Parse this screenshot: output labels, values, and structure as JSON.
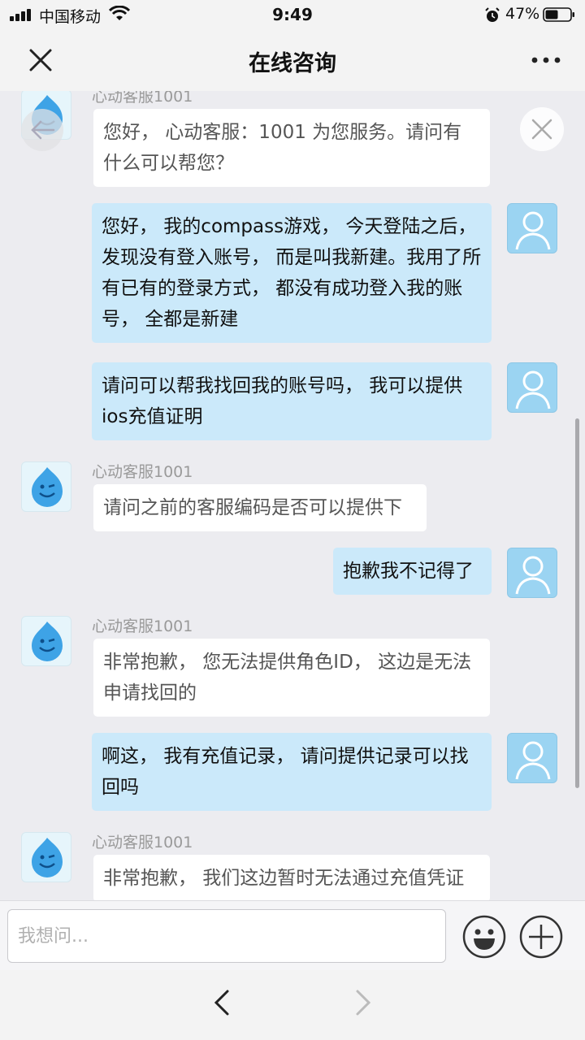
{
  "status_bar": {
    "carrier": "中国移动",
    "time": "9:49",
    "battery_percent": "47%"
  },
  "nav": {
    "title": "在线咨询"
  },
  "messages": [
    {
      "from": "agent",
      "sender": "心动客服1001",
      "text": "您好， 心动客服：1001 为您服务。请问有什么可以帮您？"
    },
    {
      "from": "user",
      "text": "您好， 我的compass游戏， 今天登陆之后，发现没有登入账号， 而是叫我新建。我用了所有已有的登录方式， 都没有成功登入我的账号， 全都是新建"
    },
    {
      "from": "user",
      "text": "请问可以帮我找回我的账号吗， 我可以提供ios充值证明"
    },
    {
      "from": "agent",
      "sender": "心动客服1001",
      "text": "请问之前的客服编码是否可以提供下"
    },
    {
      "from": "user",
      "text": "抱歉我不记得了"
    },
    {
      "from": "agent",
      "sender": "心动客服1001",
      "text": "非常抱歉， 您无法提供角色ID， 这边是无法申请找回的"
    },
    {
      "from": "user",
      "text": "啊这， 我有充值记录， 请问提供记录可以找回吗"
    },
    {
      "from": "agent",
      "sender": "心动客服1001",
      "text": "非常抱歉， 我们这边暂时无法通过充值凭证"
    }
  ],
  "input": {
    "placeholder": "我想问..."
  },
  "icons": {
    "close": "close-icon",
    "more": "more-icon",
    "back_fab": "back-arrow-icon",
    "close_fab": "close-icon",
    "emoji": "emoji-icon",
    "plus": "plus-icon",
    "nav_back": "chevron-left-icon",
    "nav_forward": "chevron-right-icon"
  },
  "colors": {
    "user_bubble": "#cbe9fa",
    "agent_bubble": "#ffffff",
    "chat_background": "#ececf0"
  }
}
